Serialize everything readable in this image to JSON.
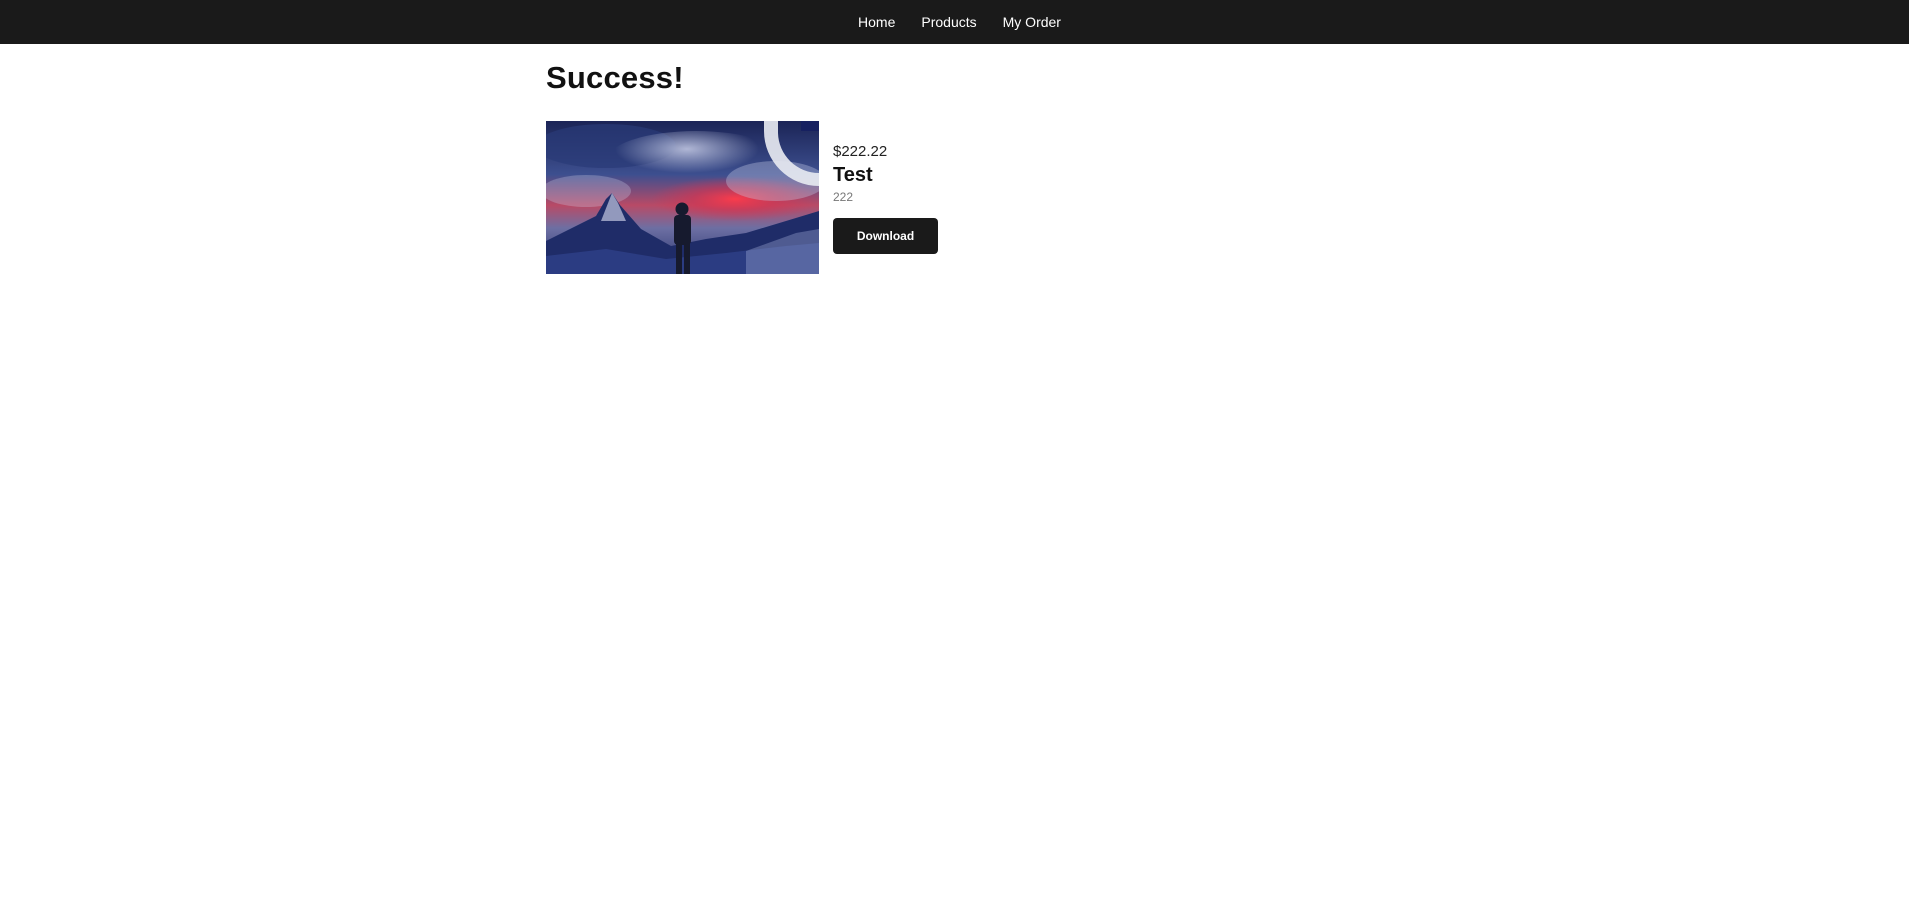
{
  "nav": {
    "items": [
      {
        "label": "Home"
      },
      {
        "label": "Products"
      },
      {
        "label": "My Order"
      }
    ]
  },
  "page": {
    "title": "Success!"
  },
  "order_item": {
    "price": "$222.22",
    "name": "Test",
    "description": "222",
    "download_label": "Download",
    "image_subject": "person-facing-mountains-under-red-and-blue-sky"
  },
  "colors": {
    "nav_background": "#1a1a1a",
    "button_background": "#1a1a1a",
    "button_text": "#ffffff"
  }
}
